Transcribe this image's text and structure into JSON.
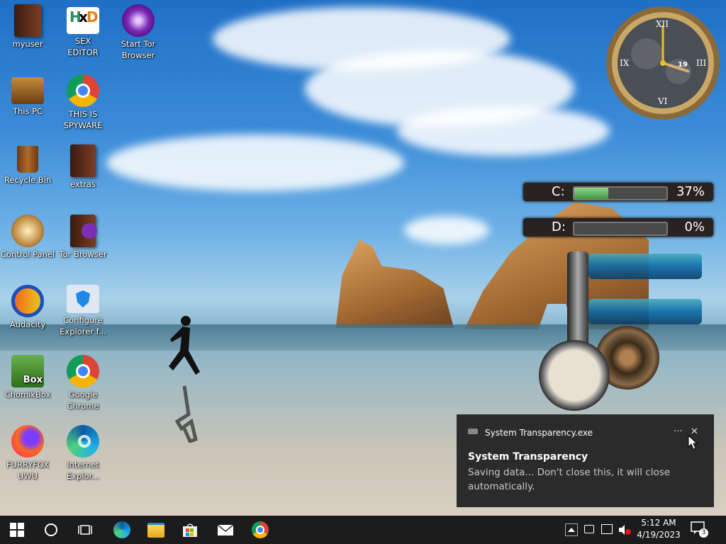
{
  "desktop_icons": [
    {
      "label": "myuser",
      "icon": "user-folder-icon"
    },
    {
      "label": "SEX\nEDITOR",
      "icon": "hex-editor-icon"
    },
    {
      "label": "Start Tor\nBrowser",
      "icon": "tor-icon"
    },
    {
      "label": "This PC",
      "icon": "computer-icon"
    },
    {
      "label": "THIS IS\nSPYWARE",
      "icon": "chrome-icon"
    },
    {
      "label": "Recycle Bin",
      "icon": "recycle-bin-icon"
    },
    {
      "label": "extras",
      "icon": "folder-icon"
    },
    {
      "label": "Control Panel",
      "icon": "control-panel-icon"
    },
    {
      "label": "Tor Browser",
      "icon": "tor-folder-icon"
    },
    {
      "label": "Audacity",
      "icon": "audacity-icon"
    },
    {
      "label": "Configure\nExplorer f...",
      "icon": "shield-icon"
    },
    {
      "label": "ChomikBox",
      "icon": "chomikbox-icon"
    },
    {
      "label": "Google\nChrome",
      "icon": "chrome-icon"
    },
    {
      "label": "FURRYFOX\nUWU",
      "icon": "firefox-icon"
    },
    {
      "label": "Internet\nExplor...",
      "icon": "edge-icon"
    }
  ],
  "clock_widget": {
    "numerals": [
      "XII",
      "III",
      "VI",
      "IX"
    ],
    "date": "19"
  },
  "drives": [
    {
      "label": "C:",
      "percent": "37%",
      "fill": 0.37
    },
    {
      "label": "D:",
      "percent": "0%",
      "fill": 0.0
    }
  ],
  "notification": {
    "app": "System Transparency.exe",
    "more": "···",
    "close": "✕",
    "title": "System Transparency",
    "body": "Saving data... Don't close this, it will close automatically."
  },
  "taskbar": {
    "time": "5:12 AM",
    "date": "4/19/2023",
    "notification_count": "3"
  },
  "colors": {
    "taskbar": "#1c1c1c",
    "notification_bg": "#2b2b2b",
    "accent": "#0078d7"
  }
}
